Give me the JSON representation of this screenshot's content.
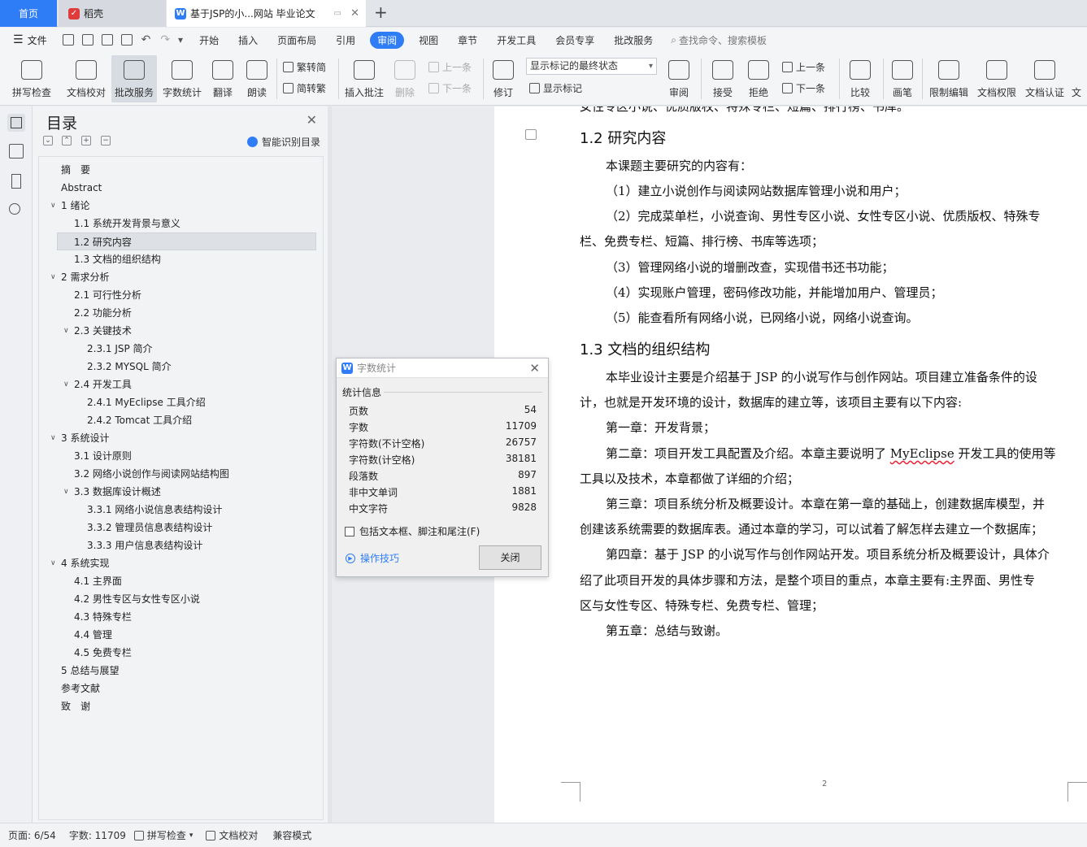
{
  "tabs": {
    "home": "首页",
    "daoke": "稻壳",
    "doc": "基于JSP的小...网站 毕业论文"
  },
  "menu": {
    "file": "文件",
    "items": [
      "开始",
      "插入",
      "页面布局",
      "引用",
      "审阅",
      "视图",
      "章节",
      "开发工具",
      "会员专享",
      "批改服务"
    ],
    "active": "审阅",
    "search": "查找命令、搜索模板"
  },
  "ribbon": {
    "spell": "拼写检查",
    "proofread": "文档校对",
    "correction": "批改服务",
    "wordcount": "字数统计",
    "translate": "翻译",
    "read": "朗读",
    "to_trad": "繁转简",
    "to_simp": "简转繁",
    "insert_comment": "插入批注",
    "delete": "删除",
    "prev": "上一条",
    "next": "下一条",
    "revise": "修订",
    "markup_select": "显示标记的最终状态",
    "show_markup": "显示标记",
    "review": "审阅",
    "accept": "接受",
    "reject": "拒绝",
    "prev2": "上一条",
    "next2": "下一条",
    "compare": "比较",
    "pen": "画笔",
    "restrict": "限制编辑",
    "permission": "文档权限",
    "certify": "文档认证",
    "cut": "文"
  },
  "toc": {
    "title": "目录",
    "smart": "智能识别目录",
    "items": [
      "摘　要",
      "Abstract",
      "1  绪论",
      "1.1  系统开发背景与意义",
      "1.2  研究内容",
      "1.3  文档的组织结构",
      "2  需求分析",
      "2.1  可行性分析",
      "2.2  功能分析",
      "2.3  关键技术",
      "2.3.1 JSP 简介",
      "2.3.2 MYSQL 简介",
      "2.4 开发工具",
      "2.4.1 MyEclipse 工具介绍",
      "2.4.2 Tomcat 工具介绍",
      "3  系统设计",
      "3.1  设计原则",
      "3.2  网络小说创作与阅读网站结构图",
      "3.3  数据库设计概述",
      "3.3.1  网络小说信息表结构设计",
      "3.3.2  管理员信息表结构设计",
      "3.3.3  用户信息表结构设计",
      "4  系统实现",
      "4.1  主界面",
      "4.2  男性专区与女性专区小说",
      "4.3  特殊专栏",
      "4.4  管理",
      "4.5  免费专栏",
      "5 总结与展望",
      "参考文献",
      "致　谢"
    ]
  },
  "doc": {
    "top_cut": "女性专区小说、优质版权、特殊专栏、短篇、排行榜、书库。",
    "h12": "1.2  研究内容",
    "p1": "本课题主要研究的内容有：",
    "p2": "（1）建立小说创作与阅读网站数据库管理小说和用户；",
    "p3a": "（2）完成菜单栏，小说查询、男性专区小说、女性专区小说、优质版权、特殊专",
    "p3b": "栏、免费专栏、短篇、排行榜、书库等选项；",
    "p4": "（3）管理网络小说的增删改查，实现借书还书功能；",
    "p5": "（4）实现账户管理，密码修改功能，并能增加用户、管理员；",
    "p6": "（5）能查看所有网络小说，已网络小说，网络小说查询。",
    "h13": "1.3  文档的组织结构",
    "q1a": "本毕业设计主要是介绍基于 JSP 的小说写作与创作网站。项目建立准备条件的设",
    "q1b": "计，也就是开发环境的设计，数据库的建立等，该项目主要有以下内容:",
    "q2": "第一章：开发背景；",
    "q3a_pre": "第二章：项目开发工具配置及介绍。本章主要说明了 ",
    "q3a_word": "MyEclipse",
    "q3a_post": " 开发工具的使用等",
    "q3b": "工具以及技术，本章都做了详细的介绍；",
    "q4a": "第三章：项目系统分析及概要设计。本章在第一章的基础上，创建数据库模型，并",
    "q4b": "创建该系统需要的数据库表。通过本章的学习，可以试着了解怎样去建立一个数据库；",
    "q5a": "第四章：基于 JSP 的小说写作与创作网站开发。项目系统分析及概要设计，具体介",
    "q5b": "绍了此项目开发的具体步骤和方法，是整个项目的重点，本章主要有:主界面、男性专",
    "q5c": "区与女性专区、特殊专栏、免费专栏、管理；",
    "q6": "第五章：总结与致谢。",
    "page_num": "2"
  },
  "dialog": {
    "title": "字数统计",
    "section": "统计信息",
    "stats": [
      {
        "label": "页数",
        "value": "54"
      },
      {
        "label": "字数",
        "value": "11709"
      },
      {
        "label": "字符数(不计空格)",
        "value": "26757"
      },
      {
        "label": "字符数(计空格)",
        "value": "38181"
      },
      {
        "label": "段落数",
        "value": "897"
      },
      {
        "label": "非中文单词",
        "value": "1881"
      },
      {
        "label": "中文字符",
        "value": "9828"
      }
    ],
    "checkbox": "包括文本框、脚注和尾注(F)",
    "tips": "操作技巧",
    "close": "关闭"
  },
  "status": {
    "page": "页面: 6/54",
    "words": "字数: 11709",
    "spell": "拼写检查",
    "proofread": "文档校对",
    "compat": "兼容模式"
  },
  "colors": {
    "accent": "#2f7df6",
    "daoke_red": "#e03b3b"
  }
}
